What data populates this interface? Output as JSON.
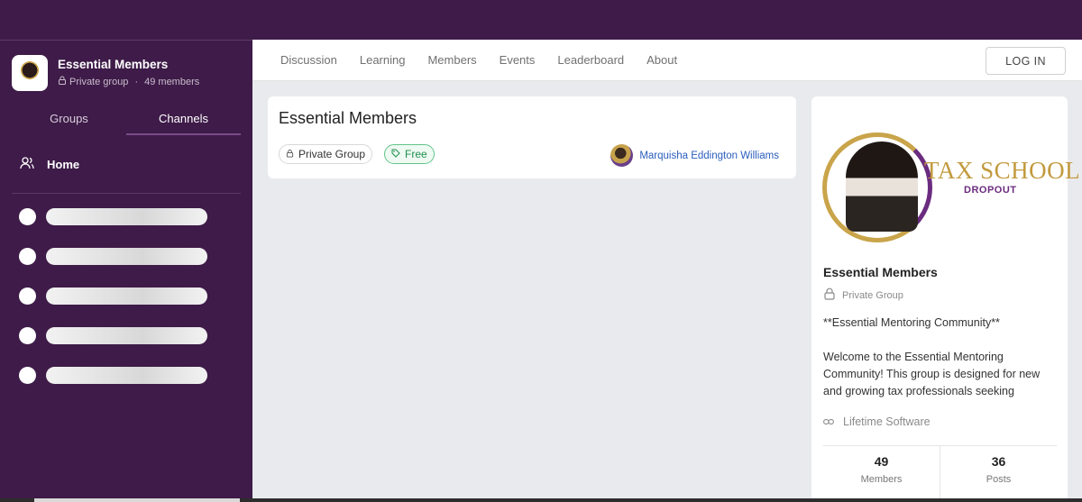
{
  "sidebar": {
    "group_name": "Essential Members",
    "privacy": "Private group",
    "separator": "·",
    "members": "49 members",
    "tabs": [
      "Groups",
      "Channels"
    ],
    "home_label": "Home"
  },
  "navbar": {
    "items": [
      "Discussion",
      "Learning",
      "Members",
      "Events",
      "Leaderboard",
      "About"
    ],
    "login_label": "LOG IN"
  },
  "main": {
    "title": "Essential Members",
    "privacy_chip": "Private Group",
    "price_chip": "Free",
    "owner_name": "Marquisha Eddington Williams"
  },
  "about": {
    "banner_title": "TAX SCHOOL",
    "banner_subtitle": "DROPOUT",
    "title": "Essential Members",
    "privacy": "Private Group",
    "desc_heading": "**Essential Mentoring Community**",
    "desc_body": "Welcome to the Essential Mentoring Community! This group is designed for new and growing tax professionals seeking",
    "link_label": "Lifetime Software",
    "stats": [
      {
        "value": "49",
        "label": "Members"
      },
      {
        "value": "36",
        "label": "Posts"
      }
    ]
  },
  "colors": {
    "brand_purple": "#3e1b48",
    "link_blue": "#2a5dbd",
    "free_green": "#1f8f4e",
    "gold": "#c29a3e"
  }
}
